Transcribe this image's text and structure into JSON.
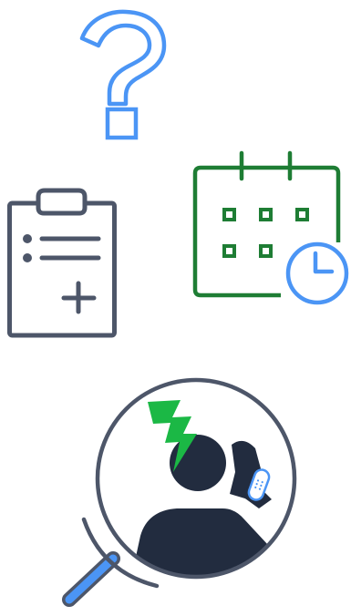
{
  "icons": [
    {
      "name": "question-mark-icon",
      "color": "#4b95f5"
    },
    {
      "name": "medical-clipboard-icon",
      "color": "#4d5669"
    },
    {
      "name": "calendar-clock-icon",
      "color": "#1e7d34",
      "clock_color": "#4b95f5"
    },
    {
      "name": "magnifier-head-injury-icon",
      "color": "#4d5669",
      "handle_color": "#4b95f5",
      "figure_color": "#222c3f",
      "lightning_color": "#1bb845"
    }
  ],
  "colors": {
    "blue": "#4b95f5",
    "slate": "#4d5669",
    "green": "#1e7d34",
    "navy": "#222c3f",
    "bright_green": "#1bb845"
  }
}
